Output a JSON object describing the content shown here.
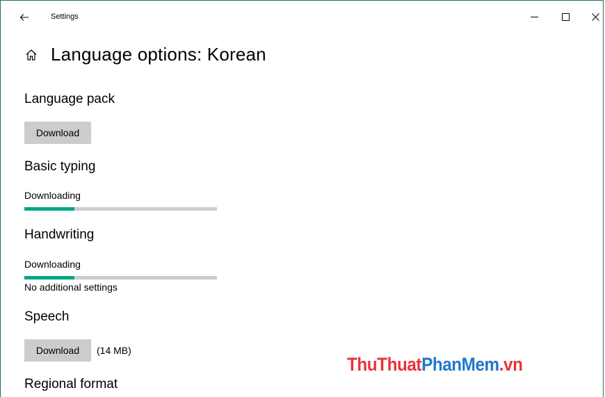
{
  "window": {
    "app_title": "Settings",
    "controls": {
      "back": "back-arrow-icon",
      "minimize": "minimize-icon",
      "maximize": "maximize-icon",
      "close": "close-icon"
    }
  },
  "page": {
    "title": "Language options: Korean",
    "home_icon": "home-icon"
  },
  "sections": {
    "language_pack": {
      "title": "Language pack",
      "button_label": "Download"
    },
    "basic_typing": {
      "title": "Basic typing",
      "status": "Downloading",
      "progress": 0.26
    },
    "handwriting": {
      "title": "Handwriting",
      "status": "Downloading",
      "progress": 0.26,
      "note": "No additional settings"
    },
    "speech": {
      "title": "Speech",
      "button_label": "Download",
      "size": "(14 MB)"
    },
    "regional_format": {
      "title": "Regional format"
    }
  },
  "watermark": {
    "part1": "ThuThuat",
    "part2": "PhanMem",
    "part3": ".vn"
  },
  "colors": {
    "accent": "#00a587",
    "button_bg": "#cccccc",
    "progress_track": "#cccccc"
  }
}
